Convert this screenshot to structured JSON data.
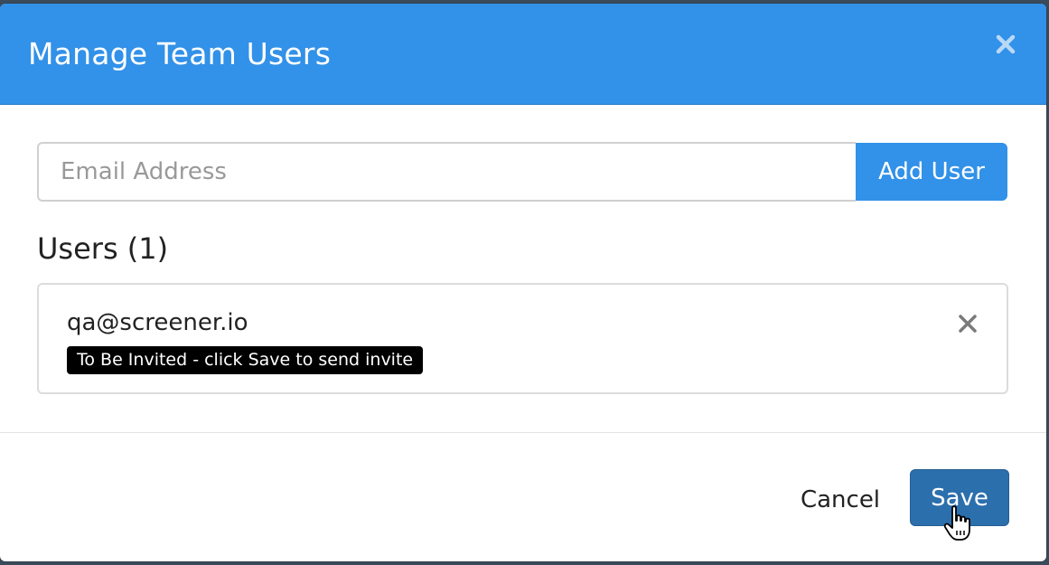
{
  "modal": {
    "title": "Manage Team Users",
    "close_icon": "close-icon"
  },
  "email_form": {
    "placeholder": "Email Address",
    "value": "",
    "add_button_label": "Add User"
  },
  "users": {
    "heading": "Users (1)",
    "items": [
      {
        "email": "qa@screener.io",
        "status": "To Be Invited - click Save to send invite",
        "remove_icon": "close-icon"
      }
    ]
  },
  "footer": {
    "cancel_label": "Cancel",
    "save_label": "Save"
  },
  "colors": {
    "header": "#3291e8",
    "add_button": "#3291e8",
    "save_button": "#2c6fad",
    "badge": "#000000"
  },
  "cursor": "hand-pointer-icon"
}
